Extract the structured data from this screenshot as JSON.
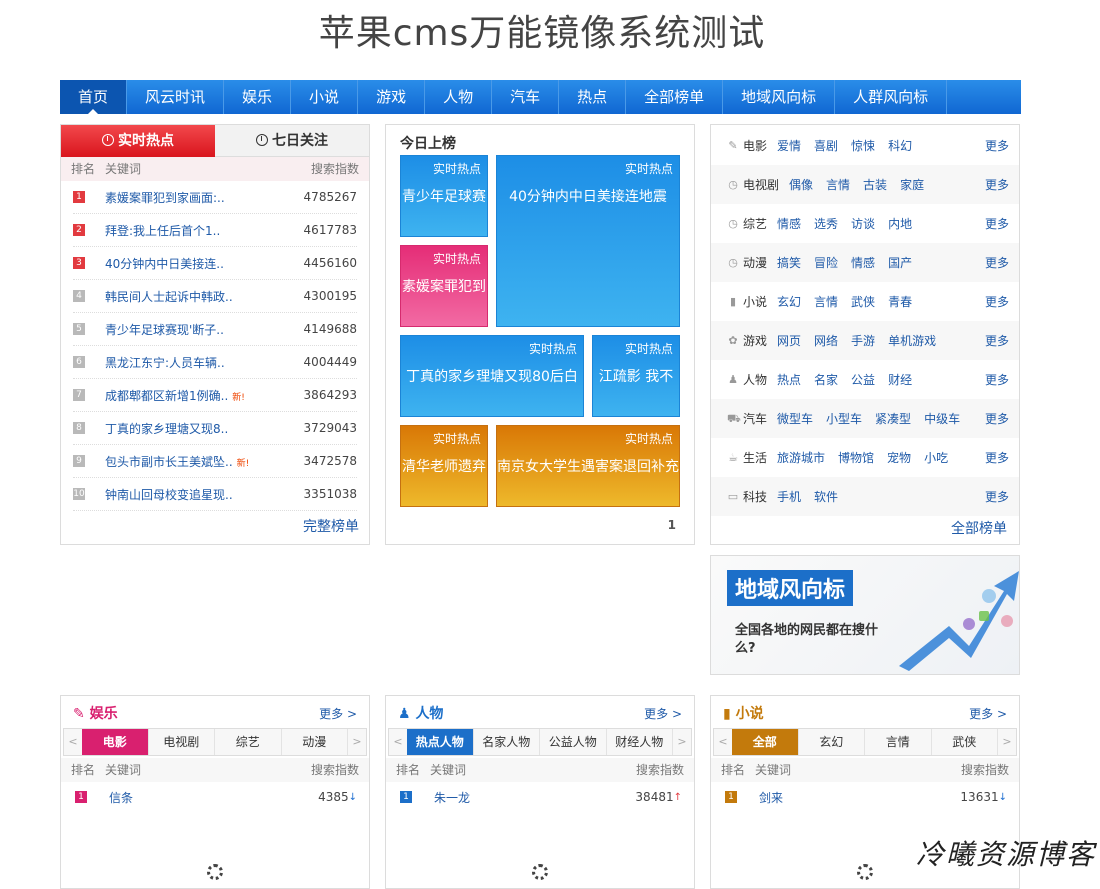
{
  "site_title": "苹果cms万能镜像系统测试",
  "nav": [
    "首页",
    "风云时讯",
    "娱乐",
    "小说",
    "游戏",
    "人物",
    "汽车",
    "热点",
    "全部榜单",
    "地域风向标",
    "人群风向标"
  ],
  "hot": {
    "tab_active": "实时热点",
    "tab_other": "七日关注",
    "col_rank": "排名",
    "col_keyword": "关键词",
    "col_index": "搜索指数",
    "rows": [
      {
        "n": "1",
        "kw": "素媛案罪犯到家画面:..",
        "idx": "4785267",
        "new": ""
      },
      {
        "n": "2",
        "kw": "拜登:我上任后首个1..",
        "idx": "4617783",
        "new": ""
      },
      {
        "n": "3",
        "kw": "40分钟内中日美接连..",
        "idx": "4456160",
        "new": ""
      },
      {
        "n": "4",
        "kw": "韩民间人士起诉中韩政..",
        "idx": "4300195",
        "new": ""
      },
      {
        "n": "5",
        "kw": "青少年足球赛现'断子..",
        "idx": "4149688",
        "new": ""
      },
      {
        "n": "6",
        "kw": "黑龙江东宁:人员车辆..",
        "idx": "4004449",
        "new": ""
      },
      {
        "n": "7",
        "kw": "成都郫都区新增1例确..",
        "idx": "3864293",
        "new": "新!"
      },
      {
        "n": "8",
        "kw": "丁真的家乡理塘又现8..",
        "idx": "3729043",
        "new": ""
      },
      {
        "n": "9",
        "kw": "包头市副市长王美斌坠..",
        "idx": "3472578",
        "new": "新!"
      },
      {
        "n": "10",
        "kw": "钟南山回母校变追星现..",
        "idx": "3351038",
        "new": ""
      }
    ],
    "full_link": "完整榜单"
  },
  "today": {
    "title": "今日上榜",
    "tag": "实时热点",
    "tiles": [
      "青少年足球赛",
      "40分钟内中日美接连地震",
      "素媛案罪犯到",
      "丁真的家乡理塘又现80后白",
      "江疏影 我不",
      "清华老师遗弃",
      "南京女大学生遇害案退回补充"
    ],
    "page": "1"
  },
  "categories": {
    "more": "更多",
    "rows": [
      {
        "icon": "✎",
        "name": "电影",
        "subs": [
          "爱情",
          "喜剧",
          "惊悚",
          "科幻"
        ]
      },
      {
        "icon": "◷",
        "name": "电视剧",
        "subs": [
          "偶像",
          "言情",
          "古装",
          "家庭"
        ]
      },
      {
        "icon": "◷",
        "name": "综艺",
        "subs": [
          "情感",
          "选秀",
          "访谈",
          "内地"
        ]
      },
      {
        "icon": "◷",
        "name": "动漫",
        "subs": [
          "搞笑",
          "冒险",
          "情感",
          "国产"
        ]
      },
      {
        "icon": "▮",
        "name": "小说",
        "subs": [
          "玄幻",
          "言情",
          "武侠",
          "青春"
        ]
      },
      {
        "icon": "✿",
        "name": "游戏",
        "subs": [
          "网页",
          "网络",
          "手游",
          "单机游戏"
        ]
      },
      {
        "icon": "♟",
        "name": "人物",
        "subs": [
          "热点",
          "名家",
          "公益",
          "财经"
        ]
      },
      {
        "icon": "⛟",
        "name": "汽车",
        "subs": [
          "微型车",
          "小型车",
          "紧凑型",
          "中级车"
        ]
      },
      {
        "icon": "☕",
        "name": "生活",
        "subs": [
          "旅游城市",
          "博物馆",
          "宠物",
          "小吃"
        ]
      },
      {
        "icon": "▭",
        "name": "科技",
        "subs": [
          "手机",
          "软件"
        ]
      }
    ],
    "all_link": "全部榜单"
  },
  "banner": {
    "title": "地域风向标",
    "subtitle": "全国各地的网民都在搜什么?"
  },
  "bottom": [
    {
      "title": "娱乐",
      "more": "更多 >",
      "color": "#d9206f",
      "tabs": [
        "电影",
        "电视剧",
        "综艺",
        "动漫"
      ],
      "col_rank": "排名",
      "col_keyword": "关键词",
      "col_index": "搜索指数",
      "row": {
        "n": "1",
        "kw": "信条",
        "idx": "4385",
        "trend": "↓"
      }
    },
    {
      "title": "人物",
      "more": "更多 >",
      "color": "#1c6fc9",
      "tabs": [
        "热点人物",
        "名家人物",
        "公益人物",
        "财经人物"
      ],
      "col_rank": "排名",
      "col_keyword": "关键词",
      "col_index": "搜索指数",
      "row": {
        "n": "1",
        "kw": "朱一龙",
        "idx": "38481",
        "trend": "↑"
      }
    },
    {
      "title": "小说",
      "more": "更多 >",
      "color": "#c37a0c",
      "tabs": [
        "全部",
        "玄幻",
        "言情",
        "武侠"
      ],
      "col_rank": "排名",
      "col_keyword": "关键词",
      "col_index": "搜索指数",
      "row": {
        "n": "1",
        "kw": "剑来",
        "idx": "13631",
        "trend": "↓"
      }
    }
  ],
  "watermark": "冷曦资源博客"
}
